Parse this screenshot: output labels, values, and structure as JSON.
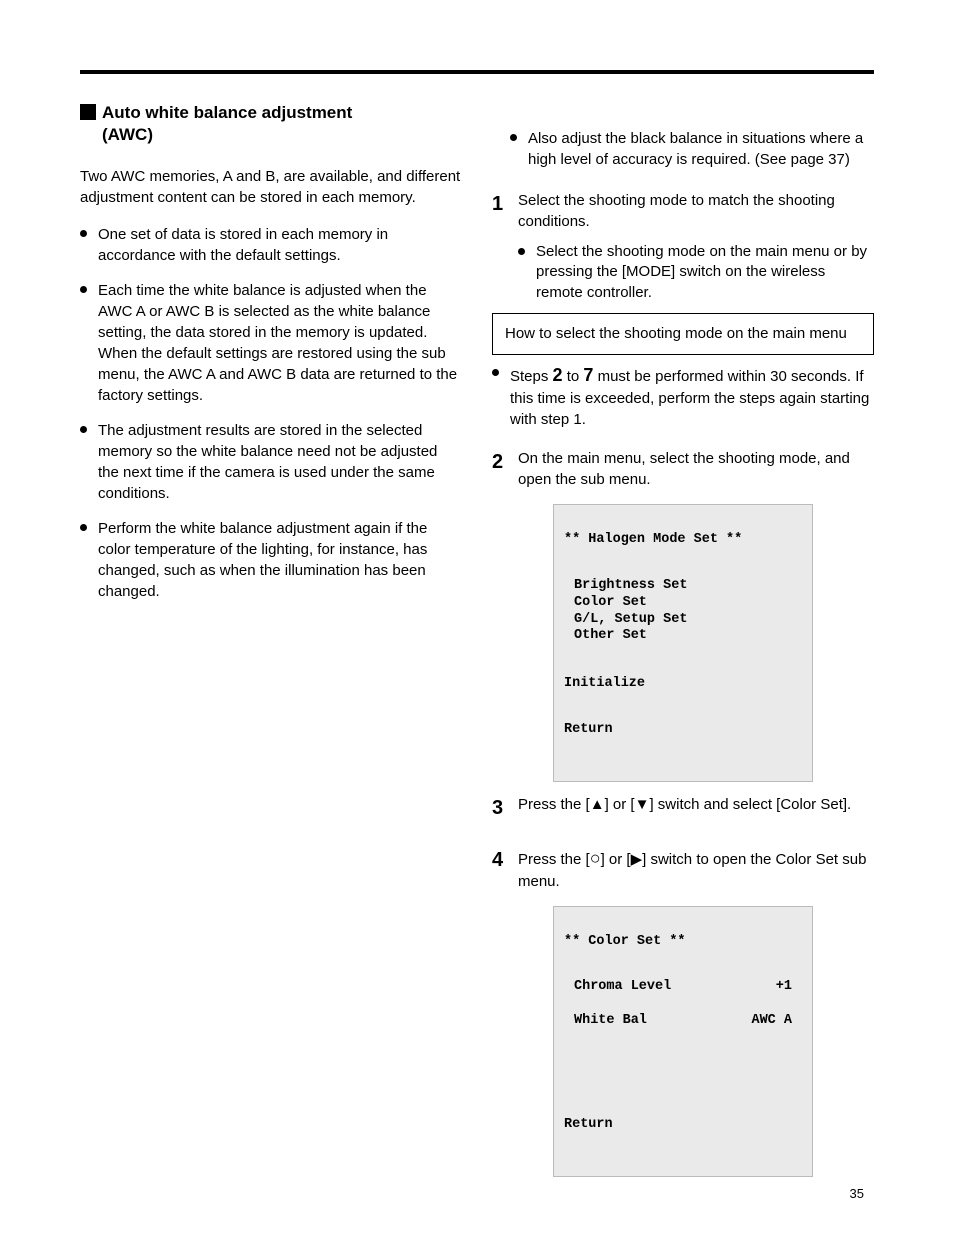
{
  "section": {
    "title_line1": "Auto white balance adjustment",
    "title_line2": "(AWC)"
  },
  "left": {
    "intro": "Two AWC memories, A and B, are available, and different adjustment content can be stored in each memory.",
    "b1": "One set of data is stored in each memory in accordance with the default settings.",
    "b2": "Each time the white balance is adjusted when the AWC A or AWC B is selected as the white balance setting, the data stored in the memory is updated. When the default settings are restored using the sub menu, the AWC A and AWC B data are returned to the factory settings.",
    "b3": "The adjustment results are stored in the selected memory so the white balance need not be adjusted the next time if the camera is used under the same conditions.",
    "b4": "Perform the white balance adjustment again if the color temperature of the lighting, for instance, has changed, such as when the illumination has been changed."
  },
  "right": {
    "b_top": "Also adjust the black balance in situations where a high level of accuracy is required. (See page 37)",
    "step1": {
      "text": "Select the shooting mode to match the shooting conditions.",
      "sub": "Select the shooting mode on the main menu or by pressing the [MODE] switch on the wireless remote controller."
    },
    "box_text": "How to select the shooting mode on the main menu",
    "note": {
      "pre": "Steps ",
      "two": "2",
      "mid": " to ",
      "seven": "7",
      "post": " must be performed within 30 seconds. If this time is exceeded, perform the steps again starting with step 1."
    },
    "step2": "On the main menu, select the shooting mode, and open the sub menu.",
    "osd1": {
      "title": "** Halogen Mode Set **",
      "items": [
        "Brightness Set",
        "Color Set",
        "G/L, Setup Set",
        "Other Set"
      ],
      "init": "Initialize",
      "ret": "Return"
    },
    "step3": {
      "pre": "Press the [",
      "up": "▲",
      "mid1": "] or [",
      "down": "▼",
      "post": "] switch and select [Color Set]."
    },
    "step4": {
      "pre": "Press the [",
      "circ": "○",
      "mid1": "] or [",
      "right": "▶",
      "post": "] switch to open the Color Set sub menu."
    },
    "osd2": {
      "title": "** Color Set **",
      "rows": [
        {
          "label": "Chroma Level",
          "value": "+1"
        },
        {
          "label": "White Bal",
          "value": "AWC A"
        }
      ],
      "ret": "Return"
    }
  },
  "page_number": "35"
}
